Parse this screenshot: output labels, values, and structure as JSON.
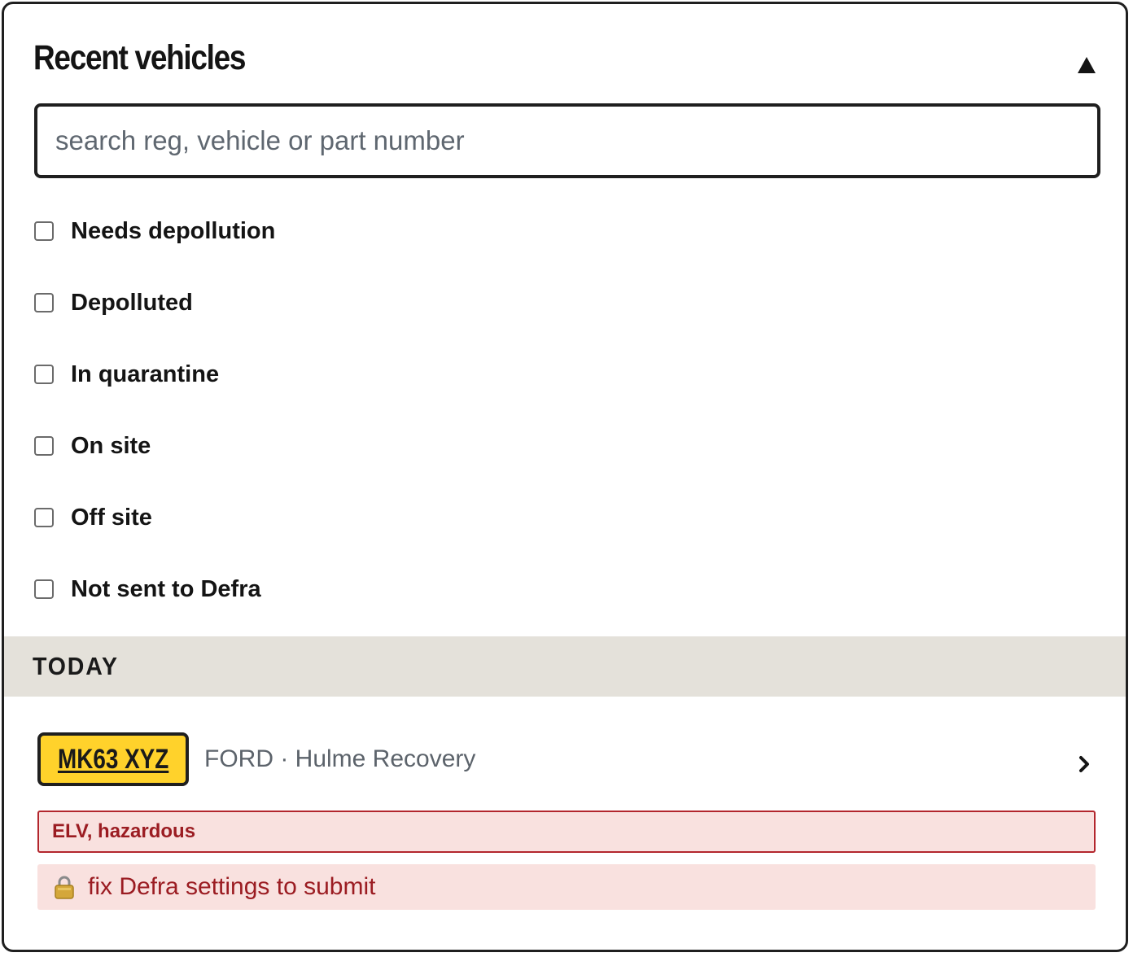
{
  "panel": {
    "title": "Recent vehicles",
    "collapse_icon": "triangle-up-icon"
  },
  "search": {
    "value": "",
    "placeholder": "search reg, vehicle or part number"
  },
  "filters": [
    {
      "label": "Needs depollution",
      "checked": false
    },
    {
      "label": "Depolluted",
      "checked": false
    },
    {
      "label": "In quarantine",
      "checked": false
    },
    {
      "label": "On site",
      "checked": false
    },
    {
      "label": "Off site",
      "checked": false
    },
    {
      "label": "Not sent to Defra",
      "checked": false
    }
  ],
  "section": {
    "label": "TODAY"
  },
  "vehicle": {
    "reg": "MK63 XYZ",
    "meta": "FORD · Hulme Recovery",
    "chevron_icon": "chevron-right-icon",
    "hazard_label": "ELV, hazardous",
    "warning_icon": "lock-icon",
    "warning_text": "fix Defra settings to submit"
  },
  "colors": {
    "plate_yellow": "#ffd22b",
    "section_bg": "#e4e1da",
    "danger_text": "#9b1c22",
    "danger_border": "#b3262d",
    "danger_bg": "#f9e1df"
  }
}
